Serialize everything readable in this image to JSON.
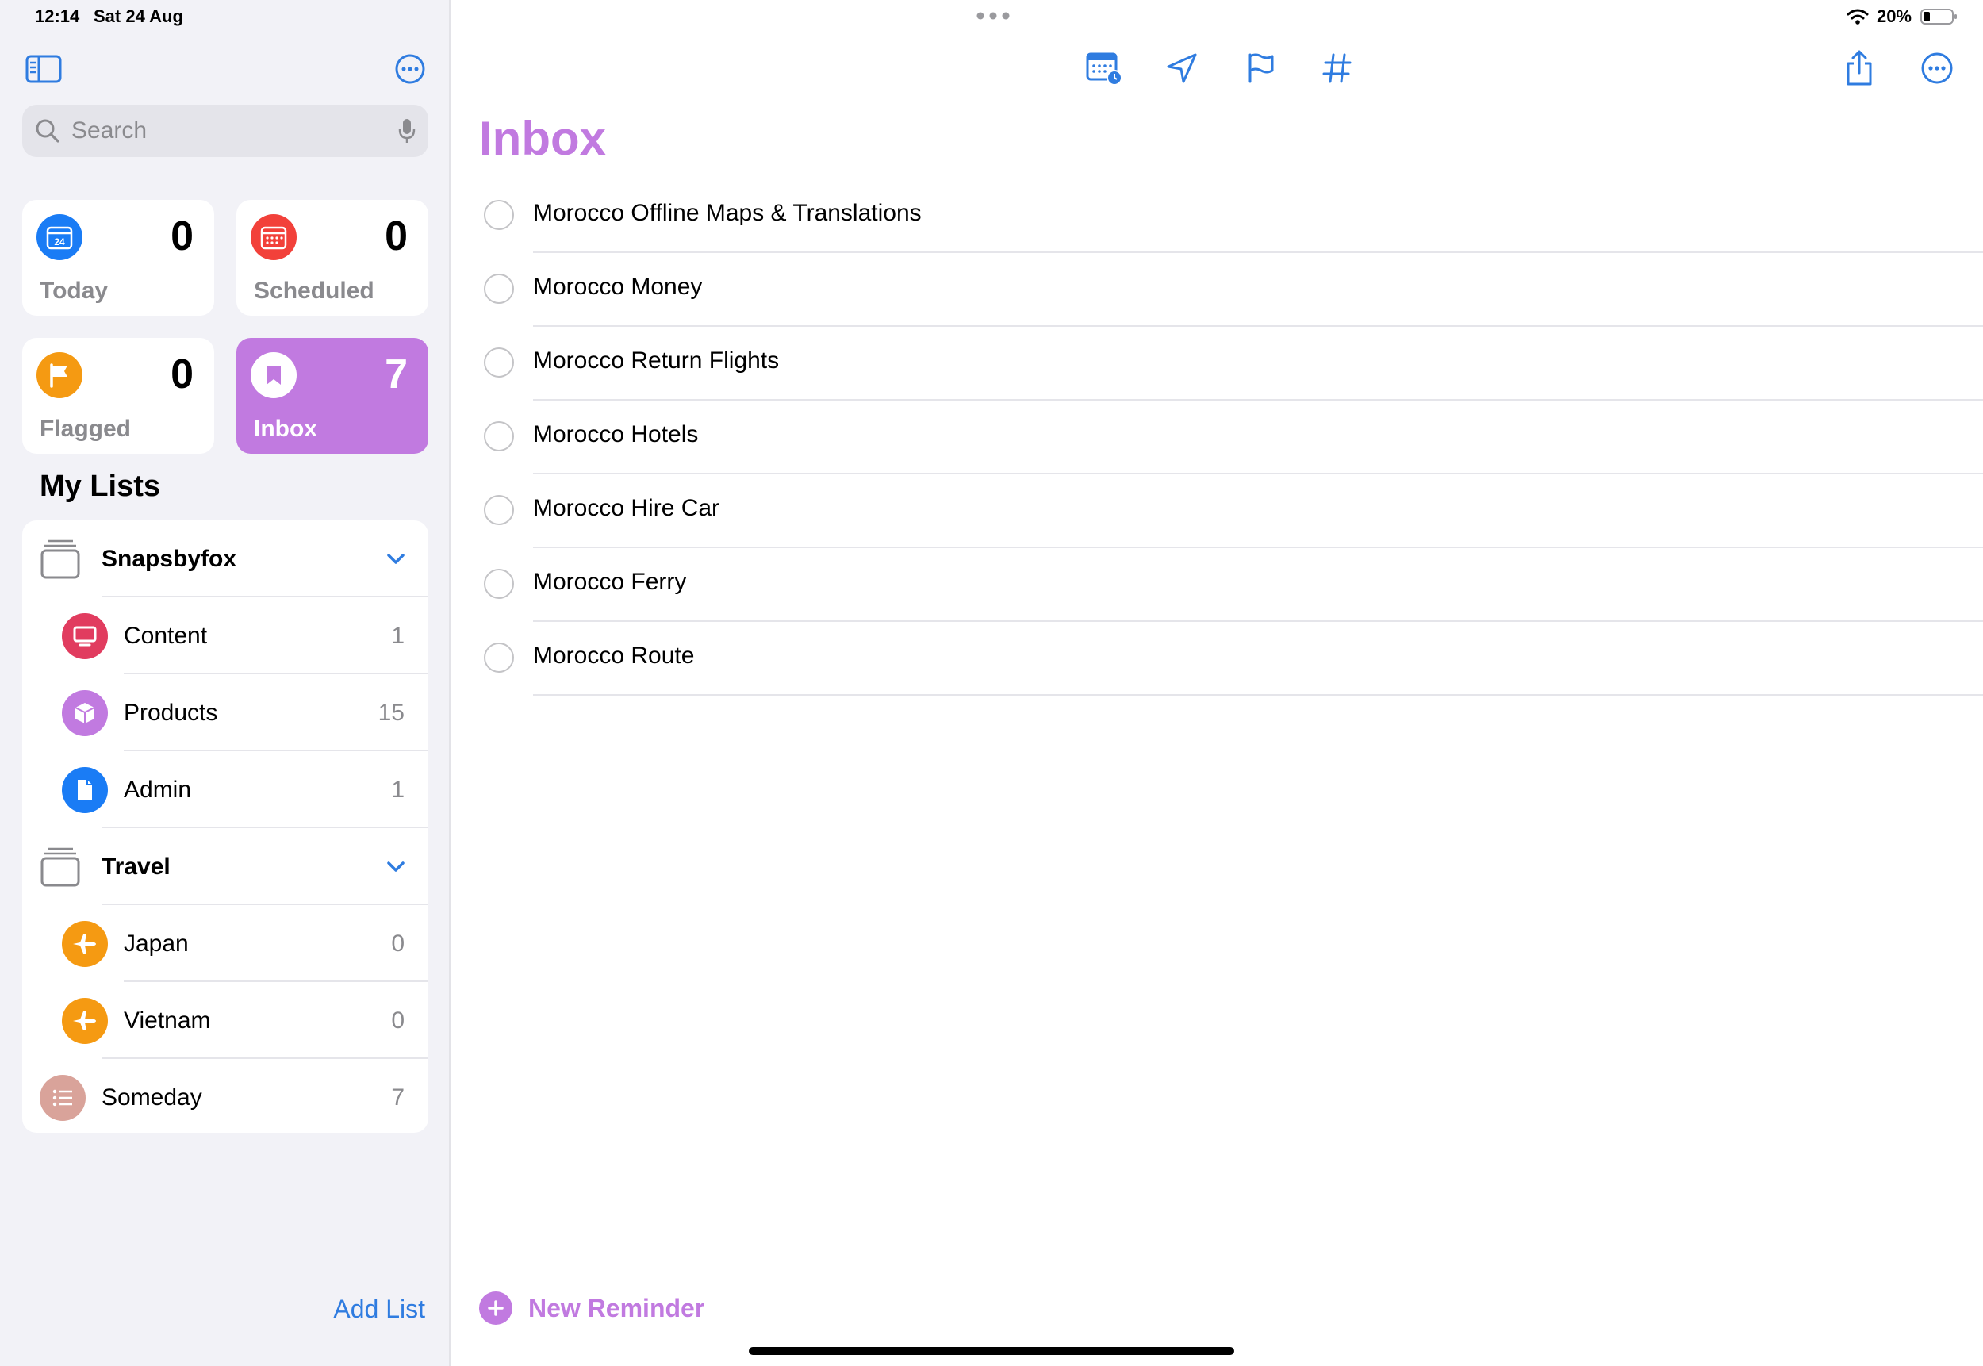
{
  "status": {
    "time": "12:14",
    "date": "Sat 24 Aug",
    "battery": "20%"
  },
  "colors": {
    "accent_purple": "#c17ae0",
    "blue": "#2f7ce0"
  },
  "sidebar": {
    "search": {
      "placeholder": "Search"
    },
    "tiles": [
      {
        "label": "Today",
        "count": "0",
        "icon": "calendar-today-icon",
        "color": "#1a7cf5",
        "icon_text": "24"
      },
      {
        "label": "Scheduled",
        "count": "0",
        "icon": "calendar-scheduled-icon",
        "color": "#f2413a"
      },
      {
        "label": "Flagged",
        "count": "0",
        "icon": "flag-icon",
        "color": "#f59a12"
      },
      {
        "label": "Inbox",
        "count": "7",
        "icon": "inbox-bookmark-icon",
        "color": "#ffffff",
        "active": true
      }
    ],
    "my_lists_title": "My Lists",
    "groups": [
      {
        "name": "Snapsbyfox",
        "lists": [
          {
            "name": "Content",
            "count": "1",
            "icon": "display-icon",
            "color": "#e13c5f"
          },
          {
            "name": "Products",
            "count": "15",
            "icon": "cube-icon",
            "color": "#c17ae0"
          },
          {
            "name": "Admin",
            "count": "1",
            "icon": "document-icon",
            "color": "#1a7cf5"
          }
        ]
      },
      {
        "name": "Travel",
        "lists": [
          {
            "name": "Japan",
            "count": "0",
            "icon": "airplane-icon",
            "color": "#f59a12"
          },
          {
            "name": "Vietnam",
            "count": "0",
            "icon": "airplane-icon",
            "color": "#f59a12"
          }
        ]
      }
    ],
    "standalone": [
      {
        "name": "Someday",
        "count": "7",
        "icon": "list-bullet-icon",
        "color": "#d9a39a"
      }
    ],
    "add_list": "Add List"
  },
  "main": {
    "title": "Inbox",
    "reminders": [
      "Morocco Offline Maps & Translations",
      "Morocco Money",
      "Morocco Return Flights",
      "Morocco Hotels",
      "Morocco Hire Car",
      "Morocco Ferry",
      "Morocco Route"
    ],
    "new_reminder": "New Reminder"
  }
}
